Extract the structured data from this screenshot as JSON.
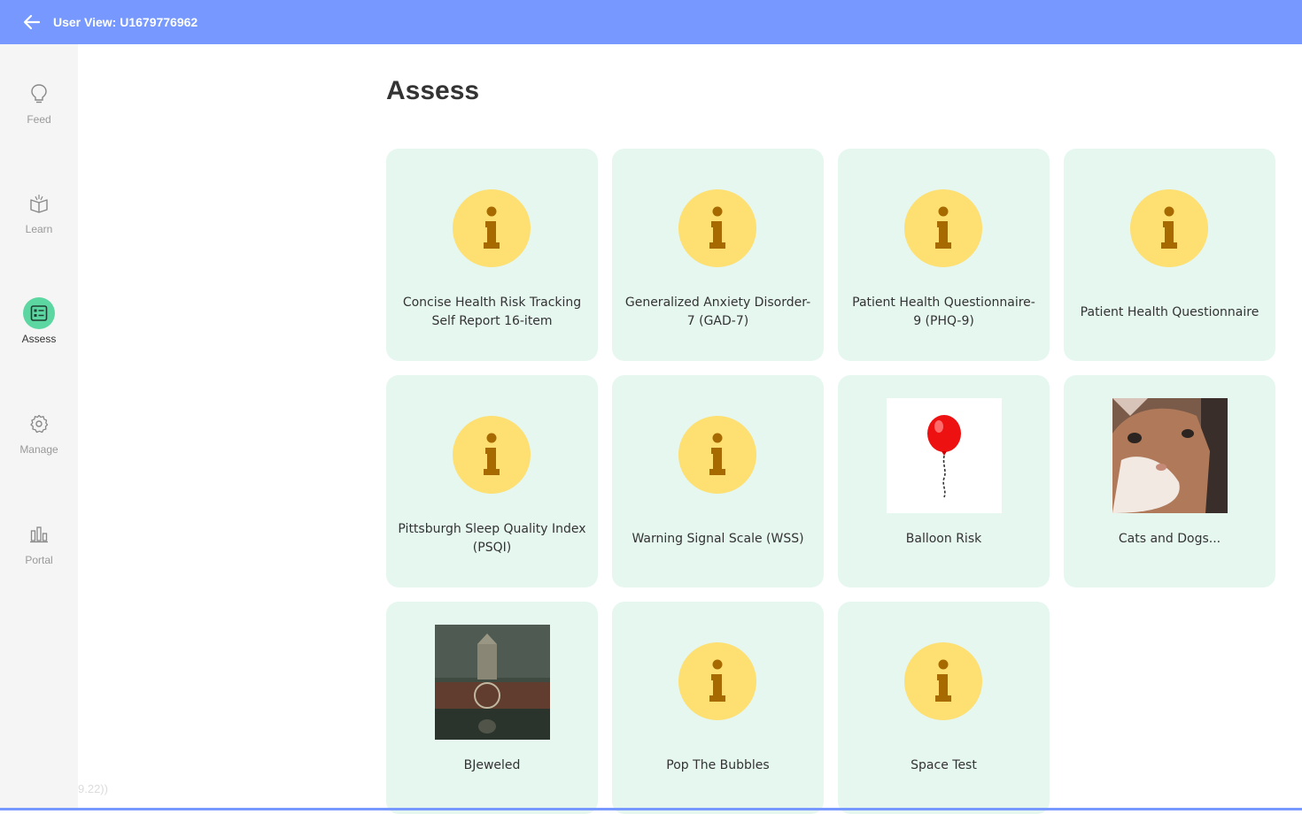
{
  "header": {
    "title": "User View: U1679776962",
    "back_icon": "arrow-left-icon",
    "background": "#7799ff"
  },
  "sidebar": {
    "items": [
      {
        "label": "Feed",
        "icon": "lightbulb-icon",
        "active": false
      },
      {
        "label": "Learn",
        "icon": "open-book-icon",
        "active": false
      },
      {
        "label": "Assess",
        "icon": "checklist-icon",
        "active": true
      },
      {
        "label": "Manage",
        "icon": "gear-icon",
        "active": false
      },
      {
        "label": "Portal",
        "icon": "bar-chart-icon",
        "active": false
      }
    ],
    "active_color": "#5dd7a2"
  },
  "version": "9.22))",
  "main": {
    "title": "Assess",
    "cards": [
      {
        "label": "Concise Health Risk Tracking Self Report 16-item",
        "image": "info-icon"
      },
      {
        "label": "Generalized Anxiety Disorder-7 (GAD-7)",
        "image": "info-icon"
      },
      {
        "label": "Patient Health Questionnaire-9 (PHQ-9)",
        "image": "info-icon"
      },
      {
        "label": "Patient Health Questionnaire",
        "image": "info-icon"
      },
      {
        "label": "Pittsburgh Sleep Quality Index (PSQI)",
        "image": "info-icon"
      },
      {
        "label": "Warning Signal Scale (WSS)",
        "image": "info-icon"
      },
      {
        "label": "Balloon Risk",
        "image": "balloon-image"
      },
      {
        "label": "Cats and Dogs...",
        "image": "cat-photo"
      },
      {
        "label": "BJeweled",
        "image": "dark-scene-photo"
      },
      {
        "label": "Pop The Bubbles",
        "image": "info-icon"
      },
      {
        "label": "Space Test",
        "image": "info-icon"
      }
    ],
    "card_color": "#e6f7f0",
    "icon_color": "#fddf72"
  }
}
